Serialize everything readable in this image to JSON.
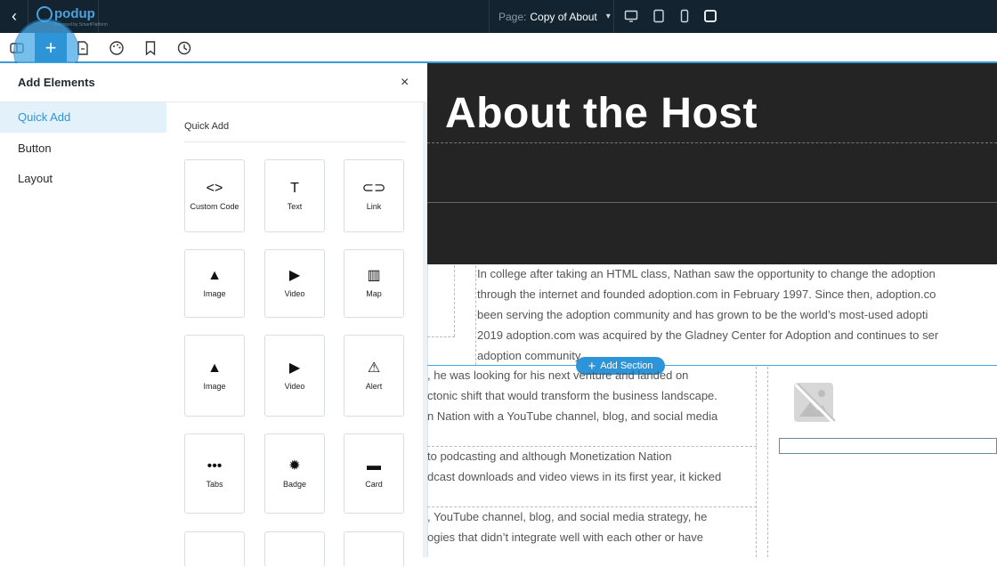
{
  "topbar": {
    "logo_text": "podup",
    "logo_sub": "Powered by SmartPlatform",
    "page_prefix": "Page:",
    "page_name": "Copy of About",
    "devices": [
      "desktop-icon",
      "tablet-icon",
      "mobile-icon",
      "square-icon"
    ]
  },
  "toolbar": {
    "tools": [
      "layers-icon",
      "add-icon",
      "pages-icon",
      "palette-icon",
      "bookmark-icon",
      "history-icon"
    ],
    "add_symbol": "+"
  },
  "panel": {
    "title": "Add Elements",
    "close_symbol": "×",
    "categories": [
      "Quick Add",
      "Button",
      "Layout"
    ],
    "quick_add_heading": "Quick Add",
    "elements": [
      {
        "label": "Custom Code",
        "glyph": "<>",
        "icon": "code-icon"
      },
      {
        "label": "Text",
        "glyph": "T",
        "icon": "text-icon"
      },
      {
        "label": "Link",
        "glyph": "⊂⊃",
        "icon": "link-icon"
      },
      {
        "label": "Image",
        "glyph": "▲",
        "icon": "image-icon"
      },
      {
        "label": "Video",
        "glyph": "▶",
        "icon": "video-icon"
      },
      {
        "label": "Map",
        "glyph": "▥",
        "icon": "map-icon"
      },
      {
        "label": "Image",
        "glyph": "▲",
        "icon": "image-icon"
      },
      {
        "label": "Video",
        "glyph": "▶",
        "icon": "video-icon"
      },
      {
        "label": "Alert",
        "glyph": "⚠",
        "icon": "alert-icon"
      },
      {
        "label": "Tabs",
        "glyph": "•••",
        "icon": "tabs-icon"
      },
      {
        "label": "Badge",
        "glyph": "✹",
        "icon": "badge-icon"
      },
      {
        "label": "Card",
        "glyph": "▬",
        "icon": "card-icon"
      }
    ]
  },
  "canvas": {
    "hero_title": "About the Host",
    "bio_lines": [
      "In college after taking an HTML class, Nathan saw the opportunity to change the adoption",
      "through the internet and founded adoption.com in February 1997. Since then, adoption.co",
      "been serving the adoption community and has grown to be the world’s most-used adopti",
      "2019 adoption.com was acquired by the Gladney Center for Adoption and continues to ser",
      "adoption community."
    ],
    "left_lines_1": [
      ", he was looking for his next venture and landed on",
      "ctonic shift that would transform the business landscape.",
      "n Nation with a YouTube channel, blog, and social media"
    ],
    "left_lines_2": [
      " to podcasting and although Monetization Nation",
      "dcast downloads and video views in its first year, it kicked"
    ],
    "left_lines_3": [
      ", YouTube channel, blog, and social media strategy, he",
      "ogies that didn’t integrate well with each other or have"
    ],
    "add_section_label": "Add Section",
    "add_section_symbol": "+"
  },
  "colors": {
    "topbar": "#13232f",
    "accent": "#2d94d8",
    "hero_bg": "#242424",
    "panel_active": "#e3f1fa"
  }
}
